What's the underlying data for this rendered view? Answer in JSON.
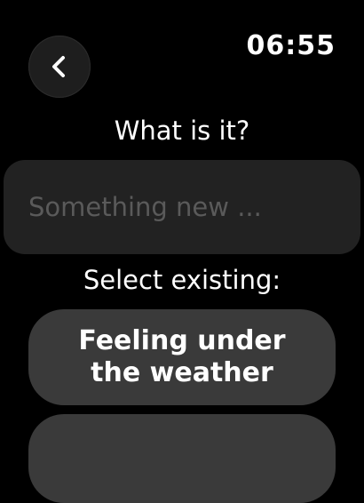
{
  "status": {
    "time": "06:55"
  },
  "header": {
    "back_icon": "chevron-left-icon"
  },
  "form": {
    "question": "What is it?",
    "input": {
      "value": "",
      "placeholder": "Something new ..."
    },
    "select_label": "Select existing:",
    "options": [
      {
        "label": "Feeling under the weather"
      },
      {
        "label": ""
      }
    ]
  },
  "colors": {
    "background": "#000000",
    "back_button": "#1e1e1e",
    "input_background": "#222222",
    "placeholder_text": "#5a5a5a",
    "option_background": "#3a3a3a",
    "text": "#ffffff"
  }
}
